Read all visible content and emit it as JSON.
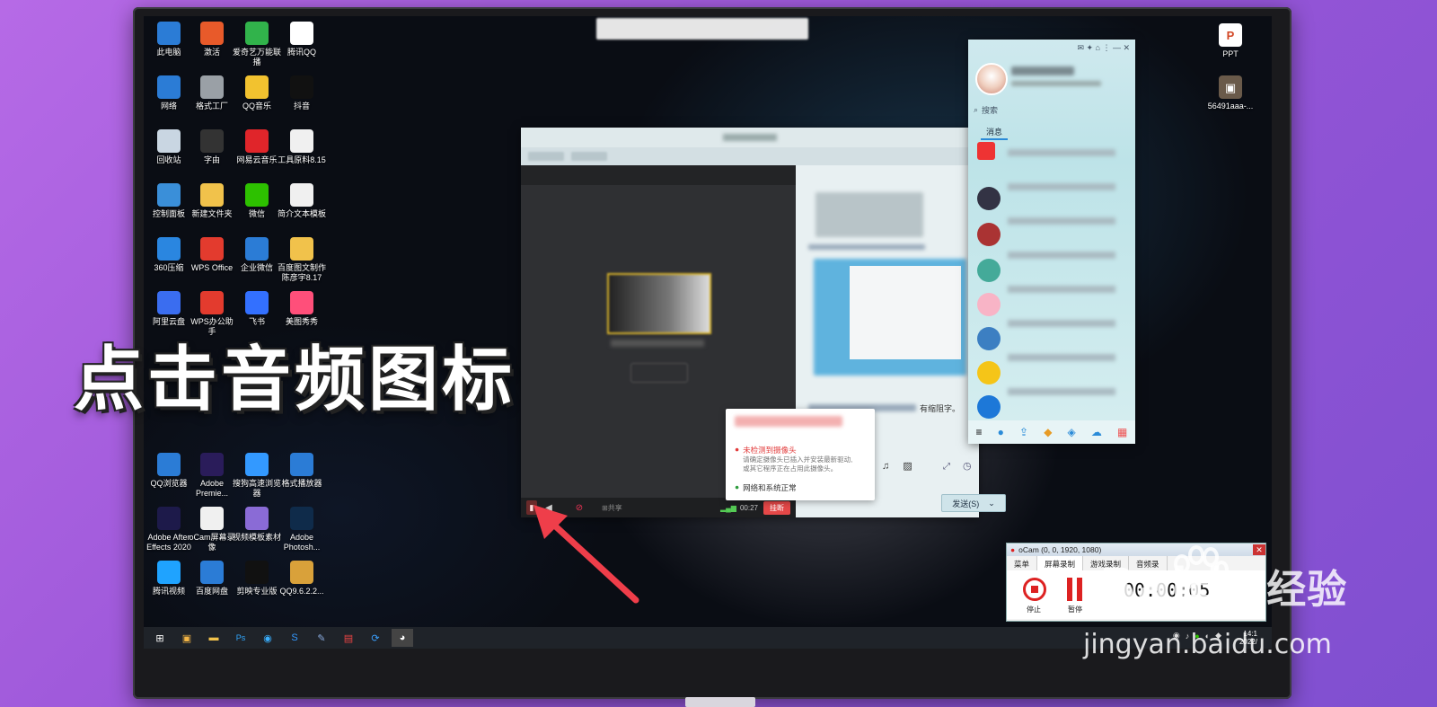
{
  "desktop": {
    "icons": [
      {
        "label": "此电脑",
        "icon": "computer-icon",
        "color": "#2b7cd6"
      },
      {
        "label": "激活",
        "icon": "windows-icon",
        "color": "#e85a2a"
      },
      {
        "label": "爱奇艺万能联播",
        "icon": "iqiyi-icon",
        "color": "#31b34b"
      },
      {
        "label": "腾讯QQ",
        "icon": "qq-icon",
        "color": "#ffffff"
      },
      {
        "label": "网络",
        "icon": "network-icon",
        "color": "#2b7cd6"
      },
      {
        "label": "格式工厂",
        "icon": "format-factory-icon",
        "color": "#9aa0a6"
      },
      {
        "label": "QQ音乐",
        "icon": "qq-music-icon",
        "color": "#f2c22f"
      },
      {
        "label": "抖音",
        "icon": "douyin-icon",
        "color": "#111111"
      },
      {
        "label": "回收站",
        "icon": "recycle-bin-icon",
        "color": "#c9d6e2"
      },
      {
        "label": "字由",
        "icon": "ziyou-icon",
        "color": "#333333"
      },
      {
        "label": "网易云音乐",
        "icon": "netease-music-icon",
        "color": "#e0252a"
      },
      {
        "label": "工具原料8.15",
        "icon": "document-icon",
        "color": "#f0f0f0"
      },
      {
        "label": "控制面板",
        "icon": "control-panel-icon",
        "color": "#3a8fd9"
      },
      {
        "label": "新建文件夹",
        "icon": "folder-icon",
        "color": "#f1c24b"
      },
      {
        "label": "微信",
        "icon": "wechat-icon",
        "color": "#2dc100"
      },
      {
        "label": "简介文本模板",
        "icon": "document-icon",
        "color": "#f0f0f0"
      },
      {
        "label": "360压缩",
        "icon": "zip-360-icon",
        "color": "#2a86e0"
      },
      {
        "label": "WPS Office",
        "icon": "wps-icon",
        "color": "#e33b2e"
      },
      {
        "label": "企业微信",
        "icon": "wecom-icon",
        "color": "#2b7cd6"
      },
      {
        "label": "百度图文制作陈彦宇8.17",
        "icon": "document-icon",
        "color": "#f1c24b"
      },
      {
        "label": "阿里云盘",
        "icon": "aliyun-drive-icon",
        "color": "#3a6df0"
      },
      {
        "label": "WPS办公助手",
        "icon": "wps-assistant-icon",
        "color": "#e33b2e"
      },
      {
        "label": "飞书",
        "icon": "feishu-icon",
        "color": "#3370ff"
      },
      {
        "label": "美图秀秀",
        "icon": "meitu-icon",
        "color": "#ff4f7a"
      },
      {
        "label": "QQ浏览器",
        "icon": "qq-browser-icon",
        "color": "#2b7cd6"
      },
      {
        "label": "Adobe Premie...",
        "icon": "premiere-icon",
        "color": "#2a1c5a"
      },
      {
        "label": "搜狗高速浏览器",
        "icon": "sogou-browser-icon",
        "color": "#3399ff"
      },
      {
        "label": "格式播放器",
        "icon": "video-player-icon",
        "color": "#2b7cd6"
      },
      {
        "label": "Adobe After Effects 2020",
        "icon": "after-effects-icon",
        "color": "#1d1a4a"
      },
      {
        "label": "oCam屏幕录像",
        "icon": "ocam-icon",
        "color": "#f0f0f0"
      },
      {
        "label": "视频模板素材",
        "icon": "folder-icon",
        "color": "#8a6bd6"
      },
      {
        "label": "Adobe Photosh...",
        "icon": "photoshop-icon",
        "color": "#0f2b4a"
      },
      {
        "label": "腾讯视频",
        "icon": "tencent-video-icon",
        "color": "#1fa3ff"
      },
      {
        "label": "百度网盘",
        "icon": "baidu-netdisk-icon",
        "color": "#2b7cd6"
      },
      {
        "label": "剪映专业版",
        "icon": "jianying-icon",
        "color": "#111111"
      },
      {
        "label": "QQ9.6.2.2...",
        "icon": "qq-installer-icon",
        "color": "#d9a13a"
      }
    ],
    "right_icons": [
      {
        "label": "PPT",
        "icon": "ppt-file-icon"
      },
      {
        "label": "56491aaa-...",
        "icon": "image-file-icon"
      }
    ]
  },
  "caption": "点击音频图标",
  "video_call": {
    "timer": "00:27",
    "hangup_label": "挂断",
    "share_label": "共享"
  },
  "tooltip": {
    "camera_error": "未检测到摄像头",
    "camera_hint_1": "请确定摄像头已插入并安装最新驱动,",
    "camera_hint_2": "或其它程序正在占用此摄像头。",
    "network_ok": "网络和系统正常"
  },
  "chat": {
    "send_label": "发送(S)",
    "partial_text": "有缩阻字。"
  },
  "qq_panel": {
    "search_placeholder": "搜索",
    "tab_messages": "消息"
  },
  "ocam": {
    "title": "oCam (0, 0, 1920, 1080)",
    "tabs": [
      "菜单",
      "屏幕录制",
      "游戏录制",
      "音频录"
    ],
    "active_tab": "屏幕录制",
    "stop_label": "停止",
    "pause_label": "暂停",
    "time": "00:00:05"
  },
  "taskbar": {
    "clock_time": "14:1",
    "clock_date": "2022/"
  },
  "watermark": {
    "brand": "Baidu",
    "brand_cn": "经验",
    "url": "jingyan.baidu.com"
  },
  "colors": {
    "accent_red": "#e54848",
    "arrow_red": "#ef3e4a",
    "background_purple": "#a65fe0"
  }
}
